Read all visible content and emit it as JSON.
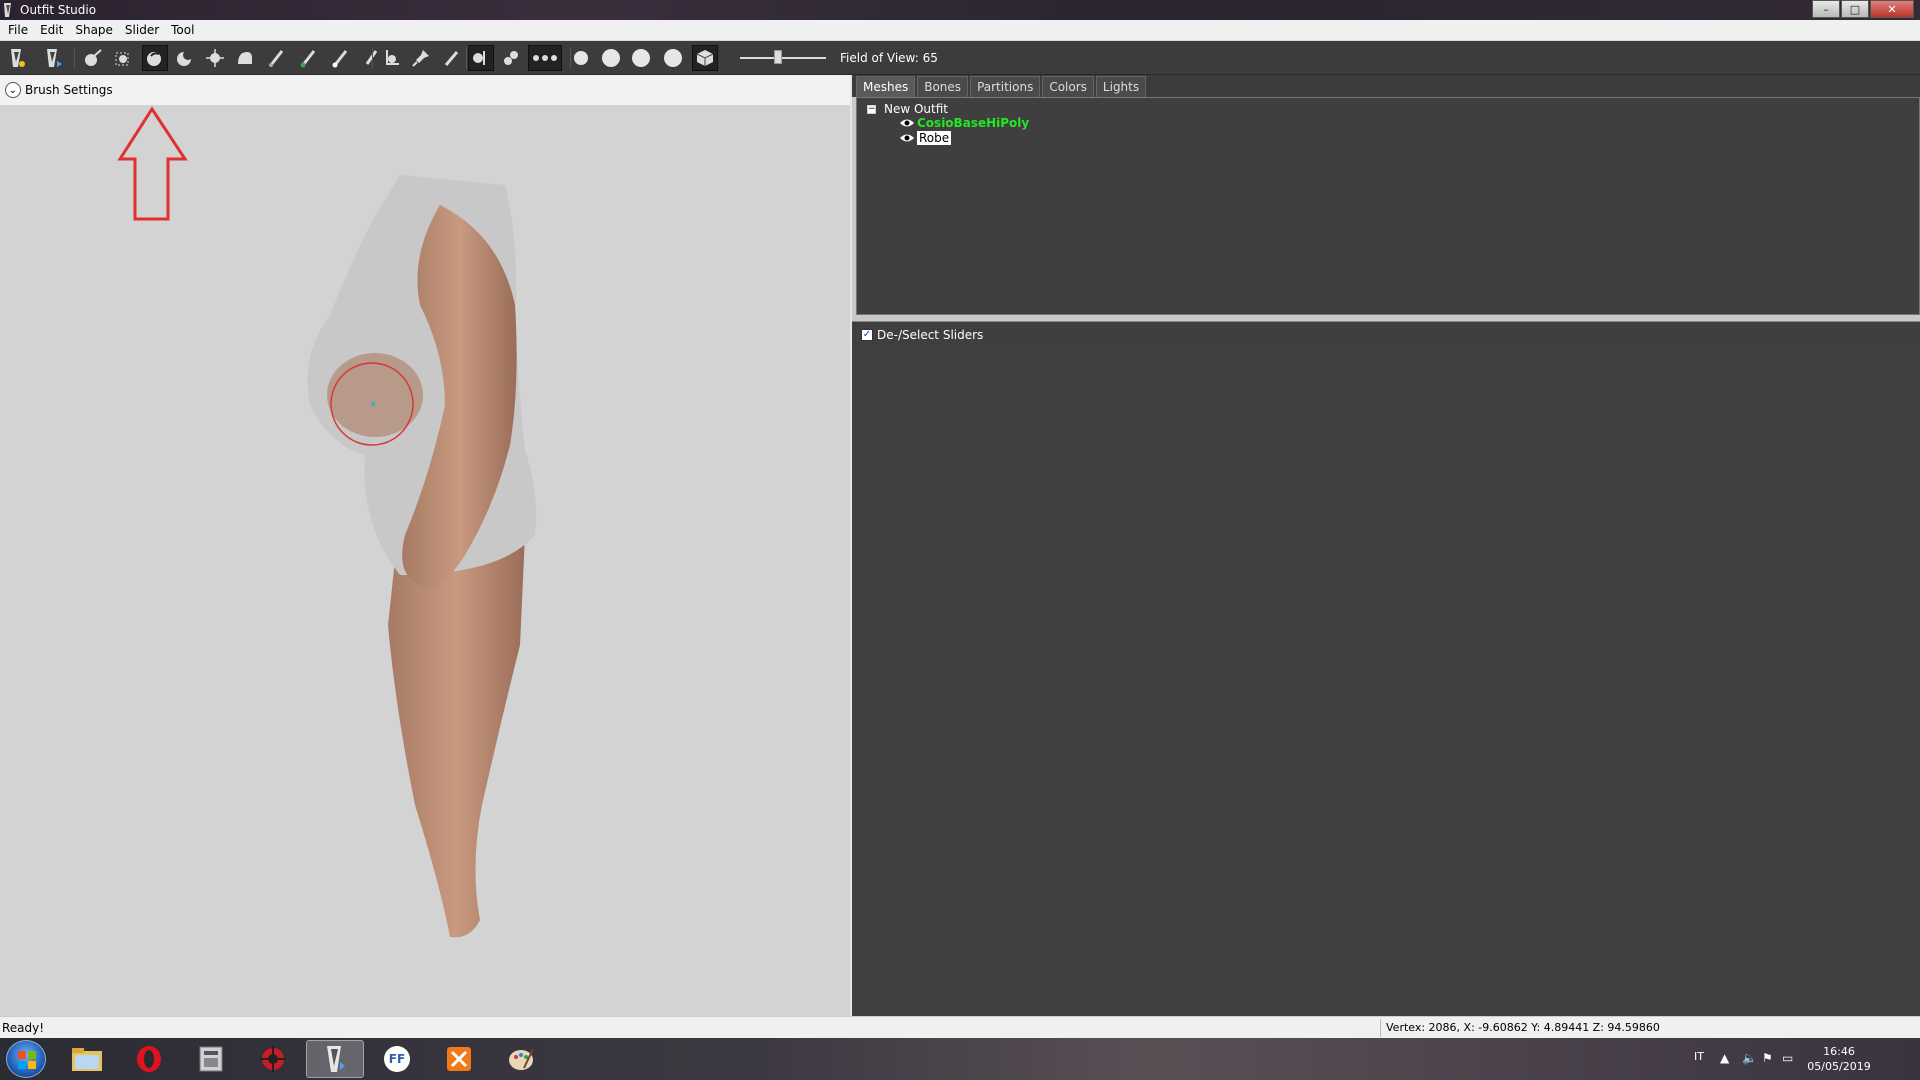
{
  "window": {
    "title": "Outfit Studio",
    "buttons": {
      "minimize": "–",
      "maximize": "□",
      "close": "✕"
    }
  },
  "menu": [
    "File",
    "Edit",
    "Shape",
    "Slider",
    "Tool"
  ],
  "toolbar": {
    "fov_label": "Field of View: 65",
    "fov_level": 0.44
  },
  "viewport": {
    "brush_settings_label": "Brush Settings",
    "background": "#d3d3d3",
    "annotation_color": "#e03030"
  },
  "right_panel": {
    "tabs": [
      "Meshes",
      "Bones",
      "Partitions",
      "Colors",
      "Lights"
    ],
    "active_tab": "Meshes",
    "tree": {
      "root": "New Outfit",
      "root_toggle": "−",
      "meshes": [
        {
          "name": "CosioBaseHiPoly",
          "color": "#22e822"
        },
        {
          "name": "Robe",
          "selected": true
        }
      ]
    },
    "sliders_toggle_label": "De-/Select Sliders",
    "sliders_checked": true
  },
  "status": {
    "left": "Ready!",
    "right": "Vertex: 2086, X: -9.60862 Y: 4.89441 Z: 94.59860"
  },
  "taskbar": {
    "apps": [
      {
        "name": "file-explorer",
        "glyph": ""
      },
      {
        "name": "opera",
        "glyph": "O",
        "color": "#e0121e"
      },
      {
        "name": "app-3",
        "glyph": ""
      },
      {
        "name": "app-4",
        "glyph": ""
      },
      {
        "name": "outfit-studio",
        "glyph": "",
        "active": true
      },
      {
        "name": "ffdec",
        "glyph": "FF",
        "color": "#2f5fb0"
      },
      {
        "name": "app-7",
        "glyph": ""
      },
      {
        "name": "paint",
        "glyph": ""
      }
    ],
    "language": "IT",
    "time": "16:46",
    "date": "05/05/2019"
  }
}
